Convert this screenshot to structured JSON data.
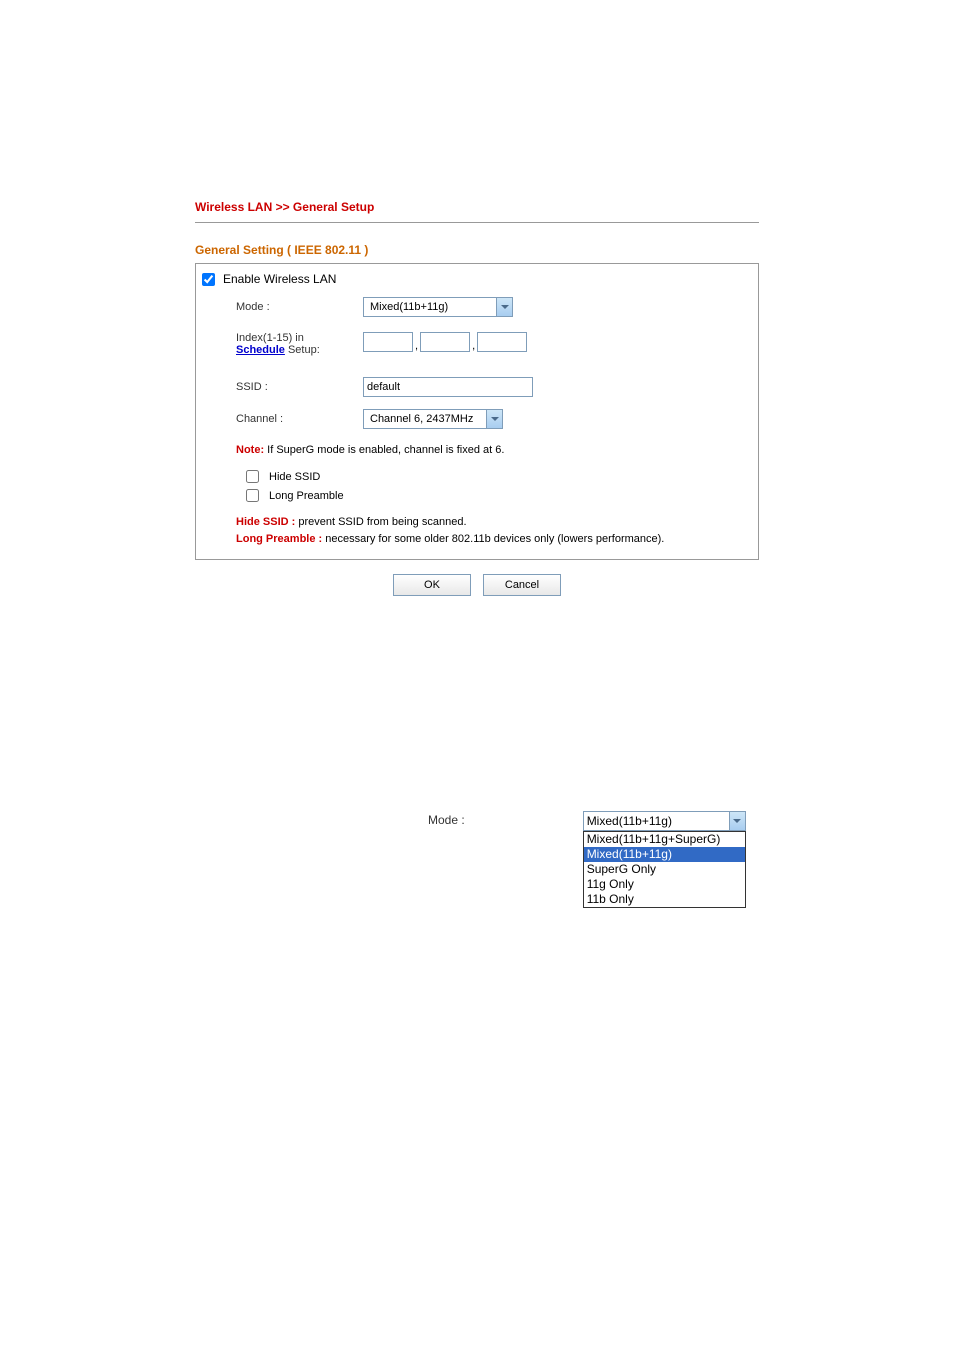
{
  "breadcrumb": "Wireless LAN >> General Setup",
  "section_title": "General Setting ( IEEE 802.11 )",
  "enable_label": "Enable Wireless LAN",
  "enable_checked": true,
  "mode": {
    "label": "Mode :",
    "value": "Mixed(11b+11g)"
  },
  "index": {
    "label_prefix": "Index(1-15) in",
    "label_link": "Schedule",
    "label_suffix": " Setup:",
    "v1": "",
    "v2": "",
    "v3": ""
  },
  "ssid": {
    "label": "SSID :",
    "value": "default"
  },
  "channel": {
    "label": "Channel :",
    "value": "Channel 6, 2437MHz"
  },
  "note": {
    "label": "Note:",
    "text": " If SuperG mode is enabled, channel is fixed at 6."
  },
  "hide_ssid": {
    "label": "Hide SSID",
    "checked": false
  },
  "long_preamble": {
    "label": "Long Preamble",
    "checked": false
  },
  "desc": {
    "hide_ssid_label": "Hide SSID :",
    "hide_ssid_text": " prevent SSID from being scanned.",
    "long_preamble_label": "Long Preamble :",
    "long_preamble_text": " necessary for some older 802.11b devices only (lowers performance)."
  },
  "buttons": {
    "ok": "OK",
    "cancel": "Cancel"
  },
  "lower": {
    "label": "Mode :",
    "selected_display": "Mixed(11b+11g)",
    "options": [
      "Mixed(11b+11g+SuperG)",
      "Mixed(11b+11g)",
      "SuperG Only",
      "11g Only",
      "11b Only"
    ],
    "selected_index": 1
  }
}
